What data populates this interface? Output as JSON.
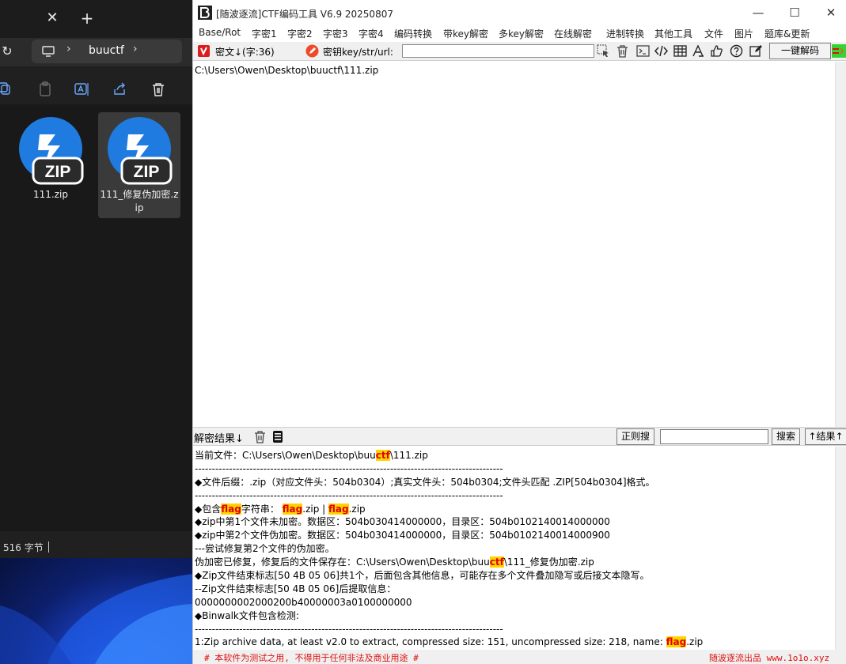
{
  "explorer": {
    "tab_close": "✕",
    "tab_new": "+",
    "refresh": "↻",
    "sep1": "›",
    "breadcrumb": "buuctf",
    "sep2": "›",
    "files": [
      {
        "badge": "ZIP",
        "name": "111.zip",
        "selected": false
      },
      {
        "badge": "ZIP",
        "name": "111_修复伪加密.zip",
        "selected": true
      }
    ],
    "status_text": "516 字节"
  },
  "tool": {
    "title": "[随波逐流]CTF编码工具 V6.9  20250807",
    "window_buttons": {
      "minimize": "—",
      "maximize": "☐",
      "close": "✕"
    },
    "menu": [
      "Base/Rot",
      "字密1",
      "字密2",
      "字密3",
      "字密4",
      "编码转换",
      "带key解密",
      "多key解密",
      "在线解密",
      "进制转换",
      "其他工具",
      "文件",
      "图片",
      "题库&更新"
    ],
    "toolbar": {
      "cipher_label": "密文↓(字:36)",
      "key_label": "密钥key/str/url:",
      "key_value": "",
      "decode_button": "一键解码"
    },
    "input_text": "C:\\Users\\Owen\\Desktop\\buuctf\\111.zip",
    "result_bar": {
      "label": "解密结果↓",
      "regex_button": "正则搜",
      "search_value": "",
      "search_button": "搜索",
      "up_button": "↑结果↑"
    },
    "output": [
      {
        "t": "line",
        "parts": [
          {
            "text": "当前文件：C:\\Users\\Owen\\Desktop\\buu"
          },
          {
            "text": "ctf",
            "hl": true
          },
          {
            "text": "\\111.zip"
          }
        ]
      },
      {
        "t": "line",
        "parts": [
          {
            "text": "------------------------------------------------------------------------------------------"
          }
        ]
      },
      {
        "t": "line",
        "parts": [
          {
            "text": "◆文件后缀：.zip（对应文件头：504b0304）;真实文件头：504b0304;文件头匹配 .ZIP[504b0304]格式。"
          }
        ]
      },
      {
        "t": "line",
        "parts": [
          {
            "text": "------------------------------------------------------------------------------------------"
          }
        ]
      },
      {
        "t": "line",
        "parts": [
          {
            "text": "◆包含"
          },
          {
            "text": "flag",
            "hl": true
          },
          {
            "text": "字符串：  "
          },
          {
            "text": "flag",
            "hl": true
          },
          {
            "text": ".zip | "
          },
          {
            "text": "flag",
            "hl": true
          },
          {
            "text": ".zip"
          }
        ]
      },
      {
        "t": "line",
        "parts": [
          {
            "text": "◆zip中第1个文件未加密。数据区：504b030414000000，目录区：504b0102140014000000"
          }
        ]
      },
      {
        "t": "line",
        "parts": [
          {
            "text": "◆zip中第2个文件伪加密。数据区：504b030414000000，目录区：504b0102140014000900"
          }
        ]
      },
      {
        "t": "line",
        "parts": [
          {
            "text": "---尝试修复第2个文件的伪加密。"
          }
        ]
      },
      {
        "t": "line",
        "parts": [
          {
            "text": "伪加密已修复，修复后的文件保存在：C:\\Users\\Owen\\Desktop\\buu"
          },
          {
            "text": "ctf",
            "hl": true
          },
          {
            "text": "\\111_修复伪加密.zip"
          }
        ]
      },
      {
        "t": "line",
        "parts": [
          {
            "text": "◆Zip文件结束标志[50 4B 05 06]共1个，后面包含其他信息，可能存在多个文件叠加隐写或后接文本隐写。"
          }
        ]
      },
      {
        "t": "line",
        "parts": [
          {
            "text": "--Zip文件结束标志[50 4B 05 06]后提取信息："
          }
        ]
      },
      {
        "t": "line",
        "parts": [
          {
            "text": "0000000002000200b40000003a0100000000"
          }
        ]
      },
      {
        "t": "line",
        "parts": [
          {
            "text": "◆Binwalk文件包含检测:"
          }
        ]
      },
      {
        "t": "line",
        "parts": [
          {
            "text": "------------------------------------------------------------------------------------------"
          }
        ]
      },
      {
        "t": "line",
        "parts": [
          {
            "text": "1:Zip archive data, at least v2.0 to extract, compressed size: 151, uncompressed size: 218, name: "
          },
          {
            "text": "flag",
            "hl": true
          },
          {
            "text": ".zip"
          }
        ]
      }
    ],
    "status_left": "# 本软件为测试之用, 不得用于任何非法及商业用途 #",
    "status_right": "随波逐流出品 www.1o1o.xyz"
  }
}
